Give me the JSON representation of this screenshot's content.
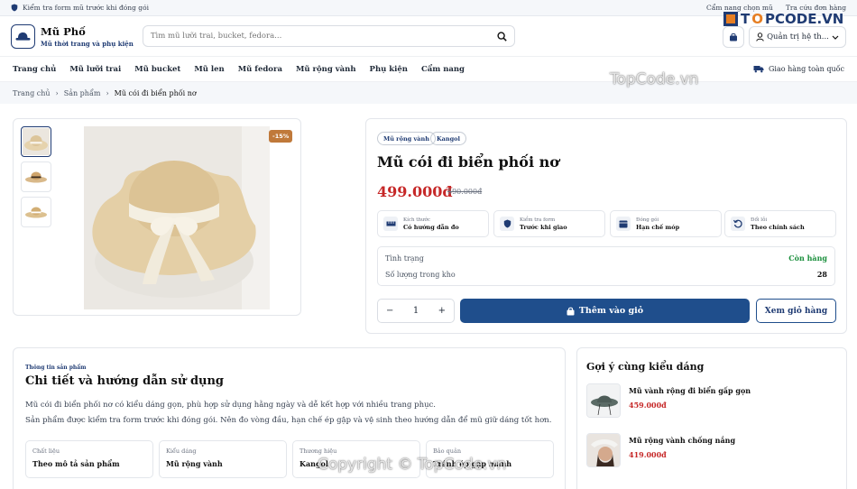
{
  "topbar": {
    "notice": "Kiểm tra form mũ trước khi đóng gói",
    "links": [
      "Cẩm nang chọn mũ",
      "Tra cứu đơn hàng"
    ]
  },
  "header": {
    "brand_name": "Mũ Phố",
    "brand_tagline": "Mũ thời trang và phụ kiện",
    "search_placeholder": "Tìm mũ lưỡi trai, bucket, fedora...",
    "account_label": "Quản trị hệ th..."
  },
  "nav": {
    "items": [
      "Trang chủ",
      "Mũ lưỡi trai",
      "Mũ bucket",
      "Mũ len",
      "Mũ fedora",
      "Mũ rộng vành",
      "Phụ kiện",
      "Cẩm nang"
    ],
    "shipping": "Giao hàng toàn quốc"
  },
  "breadcrumb": [
    "Trang chủ",
    "Sản phẩm",
    "Mũ cói đi biển phối nơ"
  ],
  "product": {
    "discount_badge": "-15%",
    "tags": [
      "Mũ rộng vành",
      "Kangol"
    ],
    "title": "Mũ cói đi biển phối nơ",
    "price": "499.000đ",
    "old_price": "590.000đ",
    "features": [
      {
        "label": "Kích thước",
        "value": "Có hướng dẫn đo",
        "icon": "ruler-icon"
      },
      {
        "label": "Kiểm tra form",
        "value": "Trước khi giao",
        "icon": "shield-icon"
      },
      {
        "label": "Đóng gói",
        "value": "Hạn chế móp",
        "icon": "box-icon"
      },
      {
        "label": "Đổi lỗi",
        "value": "Theo chính sách",
        "icon": "return-icon"
      }
    ],
    "stock_label": "Tình trạng",
    "stock_value": "Còn hàng",
    "qty_label": "Số lượng trong kho",
    "qty_value": "28",
    "quantity": "1",
    "add_to_cart": "Thêm vào giỏ",
    "view_cart": "Xem giỏ hàng"
  },
  "detail": {
    "eyebrow": "Thông tin sản phẩm",
    "title": "Chi tiết và hướng dẫn sử dụng",
    "p1": "Mũ cói đi biển phối nơ có kiểu dáng gọn, phù hợp sử dụng hằng ngày và dễ kết hợp với nhiều trang phục.",
    "p2": "Sản phẩm được kiểm tra form trước khi đóng gói. Nên đo vòng đầu, hạn chế ép gập và vệ sinh theo hướng dẫn để mũ giữ dáng tốt hơn.",
    "specs": [
      {
        "key": "Chất liệu",
        "value": "Theo mô tả sản phẩm"
      },
      {
        "key": "Kiểu dáng",
        "value": "Mũ rộng vành"
      },
      {
        "key": "Thương hiệu",
        "value": "Kangol"
      },
      {
        "key": "Bảo quản",
        "value": "Tránh ép gập mạnh"
      }
    ]
  },
  "suggest": {
    "title": "Gợi ý cùng kiểu dáng",
    "items": [
      {
        "name": "Mũ vành rộng đi biển gấp gọn",
        "price": "459.000đ"
      },
      {
        "name": "Mũ rộng vành chống nắng",
        "price": "419.000đ"
      }
    ]
  },
  "watermarks": {
    "logo_prefix": "T",
    "logo_o": "O",
    "logo_suffix": "PCODE.VN",
    "mid": "TopCode.vn",
    "bottom": "Copyright © TopCode.vn"
  },
  "colors": {
    "primary": "#1f4e8c",
    "price": "#c62828",
    "stock_ok": "#1a8f3c",
    "badge": "#c0793a"
  }
}
